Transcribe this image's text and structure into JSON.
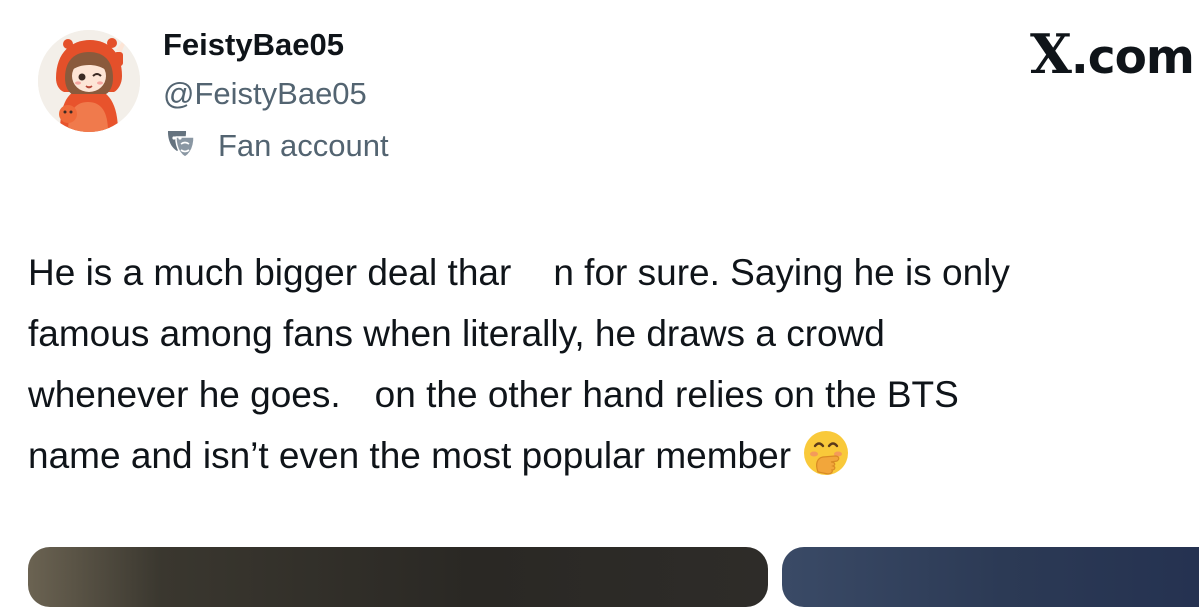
{
  "tweet": {
    "author": {
      "display_name": "FeistyBae05",
      "handle": "@FeistyBae05",
      "account_label": "Fan account",
      "avatar_icon": "avatar-image",
      "label_icon": "masks-icon"
    },
    "brand": {
      "x_glyph": "X",
      "suffix": ".com"
    },
    "text_lines": [
      {
        "before": "He is a much bigger deal thar",
        "after": "n for sure. Saying he is only"
      },
      {
        "text": "famous among fans when literally, he draws a crowd"
      },
      {
        "before": "whenever he goes.",
        "after": "on the other hand relies on the BTS"
      },
      {
        "text": "name and isn’t even the most popular member",
        "emoji": "hand-over-mouth-emoji"
      }
    ],
    "media_count": 2
  }
}
